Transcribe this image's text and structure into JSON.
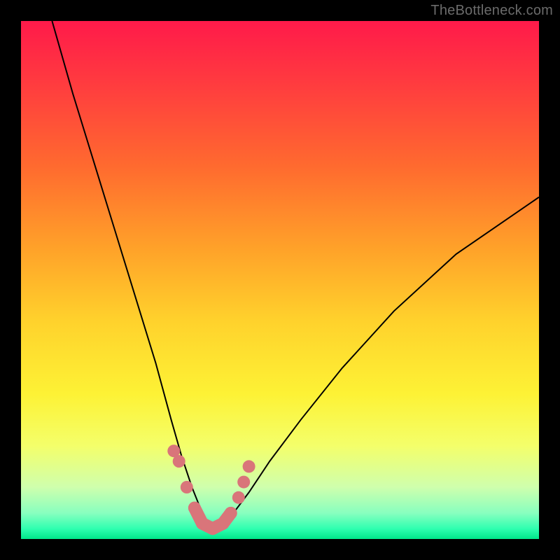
{
  "watermark": "TheBottleneck.com",
  "colors": {
    "frame": "#000000",
    "gradient_top": "#ff1a4a",
    "gradient_bottom": "#00e68a",
    "curve": "#000000",
    "marker": "#d9757a"
  },
  "chart_data": {
    "type": "line",
    "title": "",
    "xlabel": "",
    "ylabel": "",
    "xlim": [
      0,
      100
    ],
    "ylim": [
      0,
      100
    ],
    "note": "Axes have no visible tick labels; values are normalized 0–100 estimates from pixel positions. y=0 (bottom) encodes optimal/green, y=100 (top) encodes severe/red. Two curves descend into a shared minimum near x≈37.",
    "series": [
      {
        "name": "left-curve",
        "x": [
          6,
          10,
          14,
          18,
          22,
          26,
          29,
          31,
          33,
          35,
          36,
          37
        ],
        "y": [
          100,
          86,
          73,
          60,
          47,
          34,
          23,
          16,
          10,
          5,
          3,
          2
        ]
      },
      {
        "name": "right-curve",
        "x": [
          37,
          39,
          41,
          44,
          48,
          54,
          62,
          72,
          84,
          100
        ],
        "y": [
          2,
          3,
          5,
          9,
          15,
          23,
          33,
          44,
          55,
          66
        ]
      }
    ],
    "markers": {
      "name": "highlighted-points",
      "x": [
        29.5,
        30.5,
        32,
        33.5,
        35,
        37,
        39,
        40.5,
        42,
        43,
        44
      ],
      "y": [
        17,
        15,
        10,
        6,
        3,
        2,
        3,
        5,
        8,
        11,
        14
      ]
    },
    "valley_segment": {
      "name": "valley-worm",
      "x": [
        33.5,
        35,
        37,
        39,
        40.5
      ],
      "y": [
        6,
        3,
        2,
        3,
        5
      ]
    }
  }
}
